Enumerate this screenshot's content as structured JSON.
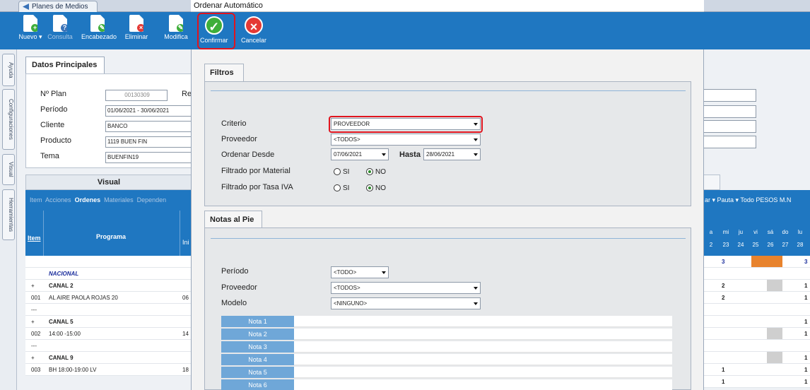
{
  "app_tab": {
    "label": "Planes de Medios"
  },
  "toolbar": {
    "buttons": [
      {
        "label": "Nuevo ▾"
      },
      {
        "label": "Consulta"
      },
      {
        "label": "Encabezado"
      },
      {
        "label": "Eliminar"
      },
      {
        "label": "Modifica"
      }
    ]
  },
  "left_tabs": [
    "Ayuda",
    "Configuraciones",
    "Visual",
    "Herramientas"
  ],
  "datos": {
    "tab_label": "Datos Principales",
    "fields": [
      {
        "label": "Nº Plan",
        "value": "00130309"
      },
      {
        "label": "Período",
        "value": "01/06/2021 - 30/06/2021"
      },
      {
        "label": "Cliente",
        "value": "BANCO"
      },
      {
        "label": "Producto",
        "value": "1119 BUEN FIN"
      },
      {
        "label": "Tema",
        "value": "BUENFIN19"
      }
    ],
    "re_label": "Re"
  },
  "visual": {
    "title": "Visual",
    "menu": [
      "Item",
      "Acciones",
      "Ordenes",
      "Materiales",
      "Dependen"
    ],
    "col_item": "Item",
    "col_programa": "Programa",
    "col_ini": "Ini",
    "rows": [
      {
        "item": "",
        "programa": "",
        "ini": ""
      },
      {
        "item": "",
        "programa": "NACIONAL",
        "ini": ""
      },
      {
        "item": "+",
        "programa": "CANAL 2",
        "ini": ""
      },
      {
        "item": "001",
        "programa": "AL AIRE PAOLA ROJAS 20",
        "ini": "06"
      },
      {
        "item": "---",
        "programa": "",
        "ini": ""
      },
      {
        "item": "+",
        "programa": "CANAL 5",
        "ini": ""
      },
      {
        "item": "002",
        "programa": "14:00 -15:00",
        "ini": "14"
      },
      {
        "item": "---",
        "programa": "",
        "ini": ""
      },
      {
        "item": "+",
        "programa": "CANAL 9",
        "ini": ""
      },
      {
        "item": "003",
        "programa": "BH 18:00-19:00 LV",
        "ini": "18"
      }
    ]
  },
  "right_panel": {
    "toolbar": "ar ▾  Pauta ▾  Todo  PESOS M.N",
    "days": [
      "a",
      "mi",
      "ju",
      "vi",
      "sá",
      "do",
      "lu"
    ],
    "dates": [
      "2",
      "23",
      "24",
      "25",
      "26",
      "27",
      "28"
    ],
    "rows": [
      {
        "left": "",
        "right": ""
      },
      {
        "left": "3",
        "right": "3"
      },
      {
        "left": "",
        "right": ""
      },
      {
        "left": "2",
        "right": "1"
      },
      {
        "left": "2",
        "right": "1"
      },
      {
        "left": "",
        "right": ""
      },
      {
        "left": "",
        "right": "1"
      },
      {
        "left": "",
        "right": "1"
      },
      {
        "left": "",
        "right": ""
      },
      {
        "left": "",
        "right": "1"
      },
      {
        "left": "1",
        "right": "1"
      },
      {
        "left": "1",
        "right": "1"
      }
    ]
  },
  "dialog": {
    "title": "Ordenar Automático",
    "confirm_label": "Confirmar",
    "cancel_label": "Cancelar",
    "filtros": {
      "tab": "Filtros",
      "criterio_label": "Criterio",
      "criterio_value": "PROVEEDOR",
      "proveedor_label": "Proveedor",
      "proveedor_value": "<TODOS>",
      "ordenar_label": "Ordenar Desde",
      "desde_value": "07/06/2021",
      "hasta_label": "Hasta",
      "hasta_value": "28/06/2021",
      "material_label": "Filtrado por Material",
      "tasa_label": "Filtrado por Tasa IVA",
      "si": "SI",
      "no": "NO"
    },
    "notas": {
      "tab": "Notas al Pie",
      "periodo_label": "Período",
      "periodo_value": "<TODO>",
      "proveedor_label": "Proveedor",
      "proveedor_value": "<TODOS>",
      "modelo_label": "Modelo",
      "modelo_value": "<NINGUNO>",
      "items": [
        "Nota 1",
        "Nota 2",
        "Nota 3",
        "Nota 4",
        "Nota 5",
        "Nota 6"
      ]
    }
  },
  "colors": {
    "accent": "#1f77c1",
    "highlight": "#e0141e",
    "confirm": "#3fae3a",
    "cancel": "#e53935"
  }
}
